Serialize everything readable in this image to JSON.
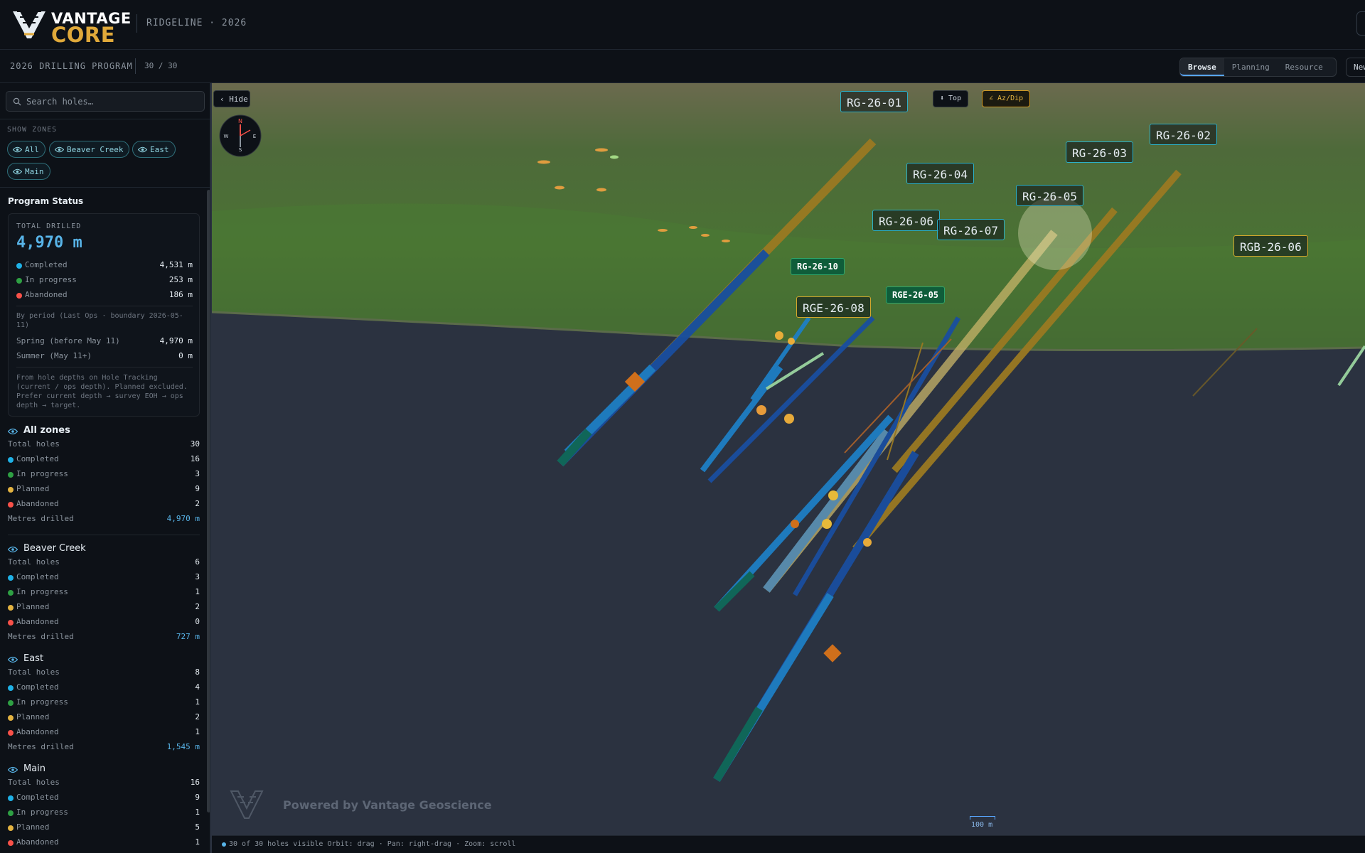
{
  "header": {
    "logo_top": "VANTAGE",
    "logo_bottom": "CORE",
    "project": "RIDGELINE · 2026"
  },
  "subheader": {
    "program_title": "2026 DRILLING PROGRAM",
    "count": "30 / 30",
    "tabs": [
      {
        "label": "Browse",
        "active": true
      },
      {
        "label": "Planning",
        "active": false
      },
      {
        "label": "Resource",
        "active": false
      }
    ],
    "new_label": "New"
  },
  "sidebar": {
    "search_placeholder": "Search holes…",
    "zones_label": "SHOW ZONES",
    "zone_chips": [
      "All",
      "Beaver Creek",
      "East",
      "Main"
    ],
    "status_title": "Program Status",
    "card": {
      "label": "TOTAL DRILLED",
      "total": "4,970 m",
      "rows": [
        {
          "label": "Completed",
          "value": "4,531 m",
          "color": "#1fb1e6"
        },
        {
          "label": "In progress",
          "value": "253 m",
          "color": "#2ea043"
        },
        {
          "label": "Abandoned",
          "value": "186 m",
          "color": "#f85149"
        }
      ],
      "period_note": "By period (Last Ops · boundary 2026-05-11)",
      "period_rows": [
        {
          "label": "Spring (before May 11)",
          "value": "4,970 m"
        },
        {
          "label": "Summer (May 11+)",
          "value": "0 m"
        }
      ],
      "footnote": "From hole depths on Hole Tracking (current / ops depth). Planned excluded. Prefer current depth → survey EOH → ops depth → target."
    },
    "zones": [
      {
        "name": "All zones",
        "rows": [
          {
            "label": "Total holes",
            "value": "30"
          },
          {
            "label": "Completed",
            "value": "16",
            "color": "#1fb1e6"
          },
          {
            "label": "In progress",
            "value": "3",
            "color": "#2ea043"
          },
          {
            "label": "Planned",
            "value": "9",
            "color": "#e3b341"
          },
          {
            "label": "Abandoned",
            "value": "2",
            "color": "#f85149"
          }
        ],
        "metres_label": "Metres drilled",
        "metres": "4,970 m"
      },
      {
        "name": "Beaver Creek",
        "rows": [
          {
            "label": "Total holes",
            "value": "6"
          },
          {
            "label": "Completed",
            "value": "3",
            "color": "#1fb1e6"
          },
          {
            "label": "In progress",
            "value": "1",
            "color": "#2ea043"
          },
          {
            "label": "Planned",
            "value": "2",
            "color": "#e3b341"
          },
          {
            "label": "Abandoned",
            "value": "0",
            "color": "#f85149"
          }
        ],
        "metres_label": "Metres drilled",
        "metres": "727 m"
      },
      {
        "name": "East",
        "rows": [
          {
            "label": "Total holes",
            "value": "8"
          },
          {
            "label": "Completed",
            "value": "4",
            "color": "#1fb1e6"
          },
          {
            "label": "In progress",
            "value": "1",
            "color": "#2ea043"
          },
          {
            "label": "Planned",
            "value": "2",
            "color": "#e3b341"
          },
          {
            "label": "Abandoned",
            "value": "1",
            "color": "#f85149"
          }
        ],
        "metres_label": "Metres drilled",
        "metres": "1,545 m"
      },
      {
        "name": "Main",
        "rows": [
          {
            "label": "Total holes",
            "value": "16"
          },
          {
            "label": "Completed",
            "value": "9",
            "color": "#1fb1e6"
          },
          {
            "label": "In progress",
            "value": "1",
            "color": "#2ea043"
          },
          {
            "label": "Planned",
            "value": "5",
            "color": "#e3b341"
          },
          {
            "label": "Abandoned",
            "value": "1",
            "color": "#f85149"
          }
        ]
      }
    ]
  },
  "viewport": {
    "hide_label": "‹ Hide",
    "view_top": "⬇ Top",
    "view_azdip": "∠ Az/Dip",
    "compass": {
      "n": "N",
      "s": "S",
      "e": "E",
      "w": "W"
    },
    "hole_labels": [
      {
        "text": "RG-26-01",
        "style": "cyan"
      },
      {
        "text": "RG-26-02",
        "style": "cyan"
      },
      {
        "text": "RG-26-03",
        "style": "cyan"
      },
      {
        "text": "RG-26-04",
        "style": "cyan"
      },
      {
        "text": "RG-26-05",
        "style": "cyan"
      },
      {
        "text": "RG-26-06",
        "style": "cyan"
      },
      {
        "text": "RG-26-07",
        "style": "cyan"
      },
      {
        "text": "RGB-26-06",
        "style": "gold"
      },
      {
        "text": "RGE-26-08",
        "style": "gold"
      },
      {
        "text": "RG-26-10",
        "style": "green"
      },
      {
        "text": "RGE-26-05",
        "style": "green"
      }
    ],
    "watermark": "Powered by Vantage Geoscience",
    "scale": "100 m"
  },
  "statusbar": {
    "text": "30 of 30 holes visible   Orbit: drag · Pan: right-drag · Zoom: scroll"
  },
  "colors": {
    "accent": "#58b4e8",
    "completed": "#1fb1e6",
    "in_progress": "#2ea043",
    "planned": "#e3b341",
    "abandoned": "#f85149"
  }
}
